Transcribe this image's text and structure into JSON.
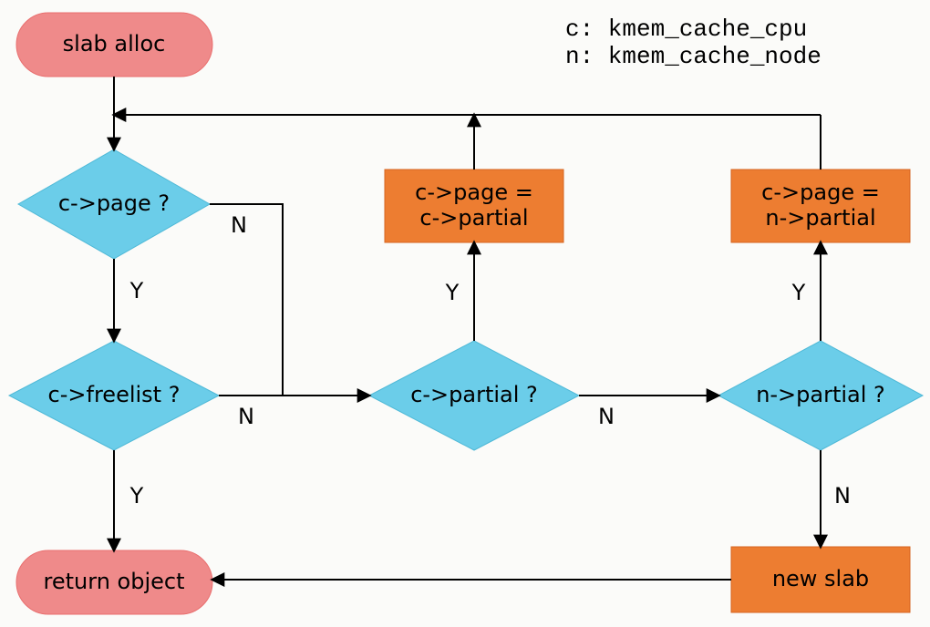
{
  "legend": {
    "line1": "c: kmem_cache_cpu",
    "line2": "n: kmem_cache_node"
  },
  "nodes": {
    "start": {
      "label": "slab alloc"
    },
    "end": {
      "label": "return object"
    },
    "d_page": {
      "label": "c->page ?"
    },
    "d_freelist": {
      "label": "c->freelist ?"
    },
    "d_cpartial": {
      "label": "c->partial ?"
    },
    "d_npartial": {
      "label": "n->partial ?"
    },
    "p_cpartial": {
      "line1": "c->page =",
      "line2": "c->partial"
    },
    "p_npartial": {
      "line1": "c->page =",
      "line2": "n->partial"
    },
    "p_newslab": {
      "label": "new slab"
    }
  },
  "edge_labels": {
    "page_n": "N",
    "page_y": "Y",
    "freelist_n": "N",
    "freelist_y": "Y",
    "cpartial_n": "N",
    "cpartial_y": "Y",
    "npartial_n": "N",
    "npartial_y": "Y"
  },
  "colors": {
    "terminal_fill": "#ef8a8a",
    "decision_fill": "#6bcde9",
    "process_fill": "#ed7d31",
    "edge": "#000000",
    "bg": "#fbfbf9"
  }
}
